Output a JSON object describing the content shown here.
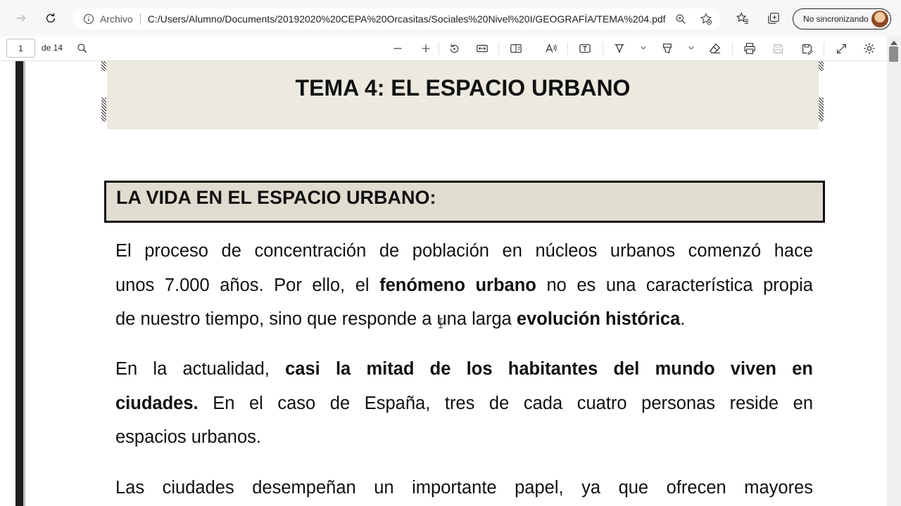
{
  "browser": {
    "back_icon": "arrow-right-icon",
    "refresh_icon": "refresh-icon",
    "address_label": "Archivo",
    "url": "C:/Users/Alumno/Documents/20192020%20CEPA%20Orcasitas/Sociales%20Nivel%20I/GEOGRAFÍA/TEMA%204.pdf",
    "sync_label": "No sincronizando"
  },
  "pdf_toolbar": {
    "page_number": "1",
    "page_count": "de 14"
  },
  "document": {
    "title": "TEMA 4: EL ESPACIO URBANO",
    "section_title": "LA VIDA EN EL ESPACIO URBANO:",
    "p1": {
      "l1": "El proceso de concentración de población en núcleos urbanos comenzó hace",
      "l2a": "unos 7.000 años. Por ello, el ",
      "l2b": "fenómeno urbano",
      "l2c": " no es una característica propia",
      "l3a": "de nuestro tiempo, sino que responde a una larga ",
      "l3b": "evolución histórica",
      "l3c": "."
    },
    "p2": {
      "l1a": "En la actualidad, ",
      "l1b": "casi la mitad de los habitantes del mundo viven en",
      "l2a": "ciudades.",
      "l2b": " En el caso de España, tres de cada cuatro personas reside en",
      "l3": "espacios urbanos."
    },
    "p3": {
      "l1": "Las ciudades desempeñan un importante papel, ya que ofrecen mayores"
    }
  },
  "colors": {
    "title_box": "#ece9df",
    "section_box": "#e0ddd0",
    "toolbar_bg": "#f7f7f7"
  }
}
